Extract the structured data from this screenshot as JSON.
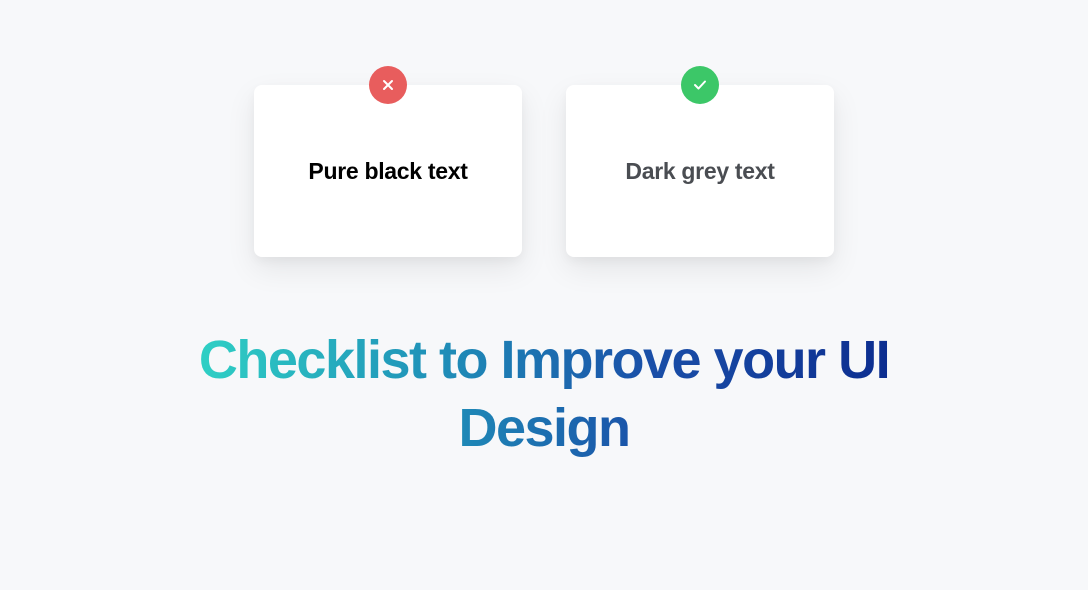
{
  "cards": {
    "bad": {
      "text": "Pure black text"
    },
    "good": {
      "text": "Dark grey text"
    }
  },
  "headline": "Checklist to Improve your UI Design",
  "colors": {
    "background": "#f7f8fa",
    "card_bg": "#ffffff",
    "badge_bad": "#e85d5d",
    "badge_good": "#3cc768",
    "pure_black": "#000000",
    "dark_grey": "#4a4d52",
    "gradient_start": "#2fd1c5",
    "gradient_end": "#0c2d8f"
  }
}
